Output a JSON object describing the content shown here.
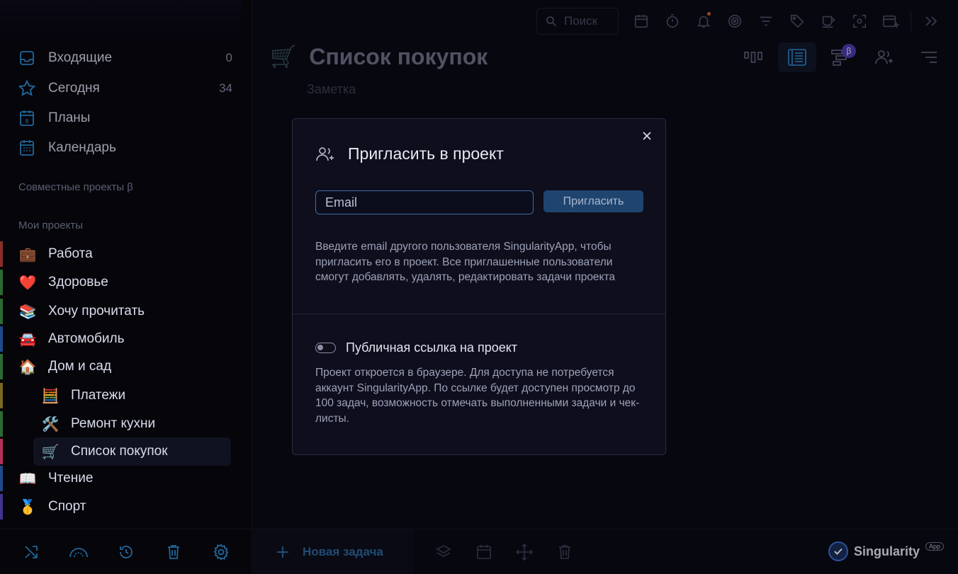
{
  "sidebar": {
    "nav": [
      {
        "label": "Входящие",
        "count": "0",
        "icon": "inbox-icon"
      },
      {
        "label": "Сегодня",
        "count": "34",
        "icon": "star-icon"
      },
      {
        "label": "Планы",
        "count": "",
        "icon": "calendar-day-icon"
      },
      {
        "label": "Календарь",
        "count": "",
        "icon": "calendar-grid-icon"
      }
    ],
    "shared_label": "Совместные проекты β",
    "my_projects_label": "Мои проекты",
    "projects": [
      {
        "label": "Работа",
        "emoji": "💼",
        "color": "#c8423a"
      },
      {
        "label": "Здоровье",
        "emoji": "❤️",
        "color": "#3a9a4a"
      },
      {
        "label": "Хочу прочитать",
        "emoji": "📚",
        "color": "#3a9a4a"
      },
      {
        "label": "Автомобиль",
        "emoji": "🚘",
        "color": "#2e62b8"
      },
      {
        "label": "Дом и сад",
        "emoji": "🏠",
        "color": "#3a9a4a"
      },
      {
        "label": "Платежи",
        "emoji": "🧮",
        "color": "#b59c2a"
      },
      {
        "label": "Ремонт кухни",
        "emoji": "🛠️",
        "color": "#3a9a4a"
      },
      {
        "label": "Список покупок",
        "emoji": "🛒",
        "color": "#d13a62"
      },
      {
        "label": "Чтение",
        "emoji": "📖",
        "color": "#2e62b8"
      },
      {
        "label": "Спорт",
        "emoji": "🥇",
        "color": "#5a4bb8"
      }
    ],
    "bottom_icons": [
      "shuffle-icon",
      "arc-icon",
      "history-icon",
      "trash-icon",
      "gear-icon"
    ]
  },
  "topbar": {
    "search_placeholder": "Поиск",
    "icons": [
      "calendar-icon",
      "timer-icon",
      "bell-icon",
      "target-icon",
      "filter-icon",
      "tag-icon",
      "cup-icon",
      "focus-icon",
      "add-window-icon",
      "expand-icon"
    ]
  },
  "page": {
    "title": "Список покупок",
    "note_placeholder": "Заметка",
    "view_icons": [
      "columns-icon",
      "list-icon",
      "gantt-icon",
      "add-user-icon",
      "sort-icon"
    ],
    "beta": "β"
  },
  "bottom": {
    "new_task": "Новая задача",
    "brand": "Singularity",
    "brand_badge": "App"
  },
  "modal": {
    "title": "Пригласить в проект",
    "email_placeholder": "Email",
    "invite_button": "Пригласить",
    "invite_desc": "Введите email другого пользователя SingularityApp, чтобы пригласить его в проект. Все приглашенные пользователи смогут добавлять, удалять, редактировать задачи проекта",
    "public_label": "Публичная ссылка на проект",
    "public_desc": "Проект откроется в браузере. Для доступа не потребуется аккаунт SingularityApp. По ссылке будет доступен просмотр до 100 задач, возможность отмечать выполненными задачи и чек-листы.",
    "public_enabled": false
  },
  "colors": {
    "accent": "#2f6aa3",
    "input_border": "#3b6fa8",
    "button_bg": "#1f456f"
  }
}
